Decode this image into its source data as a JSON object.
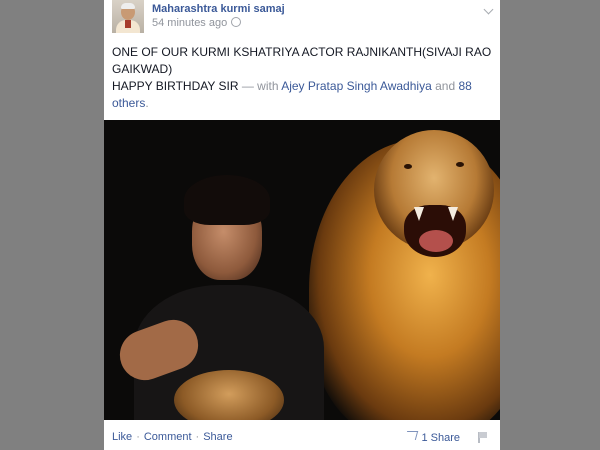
{
  "post": {
    "poster_name": "Maharashtra kurmi samaj",
    "timestamp": "54 minutes ago",
    "text_line1": "ONE OF OUR KURMI KSHATRIYA ACTOR RAJNIKANTH(SIVAJI RAO GAIKWAD)",
    "text_line2_prefix": "HAPPY BIRTHDAY SIR",
    "with_connector": "— with",
    "tagged_person": "Ajey Pratap Singh Awadhiya",
    "and_word": "and",
    "others_link": "88 others",
    "period": "."
  },
  "actions": {
    "like": "Like",
    "separator": "·",
    "comment": "Comment",
    "share": "Share",
    "share_count": "1 Share"
  },
  "icons": {
    "privacy": "globe-icon",
    "options": "chevron-down-icon",
    "shares": "share-arrow-icon",
    "report": "flag-icon"
  }
}
